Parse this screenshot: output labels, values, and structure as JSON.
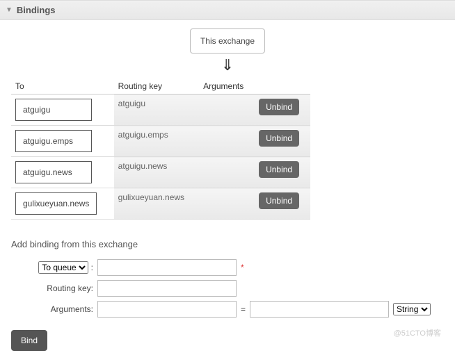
{
  "section": {
    "title": "Bindings"
  },
  "diagram": {
    "label": "This exchange"
  },
  "table": {
    "headers": {
      "to": "To",
      "routing_key": "Routing key",
      "arguments": "Arguments"
    },
    "rows": [
      {
        "to": "atguigu",
        "routing_key": "atguigu",
        "arguments": "",
        "action": "Unbind"
      },
      {
        "to": "atguigu.emps",
        "routing_key": "atguigu.emps",
        "arguments": "",
        "action": "Unbind"
      },
      {
        "to": "atguigu.news",
        "routing_key": "atguigu.news",
        "arguments": "",
        "action": "Unbind"
      },
      {
        "to": "gulixueyuan.news",
        "routing_key": "gulixueyuan.news",
        "arguments": "",
        "action": "Unbind"
      }
    ]
  },
  "add_form": {
    "title": "Add binding from this exchange",
    "target_select": "To queue",
    "colon": ":",
    "routing_key_label": "Routing key:",
    "arguments_label": "Arguments:",
    "type_select": "String",
    "required_mark": "*",
    "equals": "=",
    "bind_button": "Bind"
  },
  "watermark": "@51CTO博客"
}
